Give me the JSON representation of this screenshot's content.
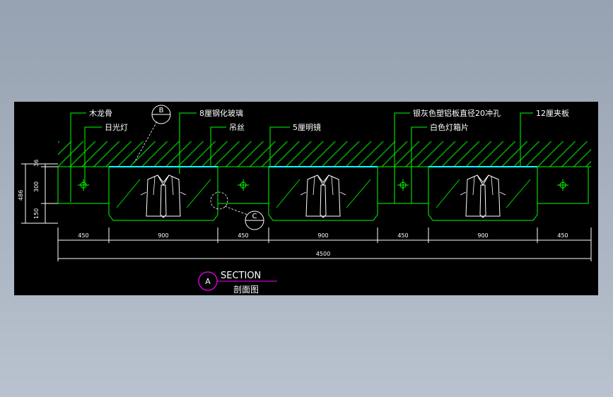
{
  "labels": {
    "wood_keel": "木龙骨",
    "daylight_lamp": "日光灯",
    "tempered_glass": "8厘钢化玻璃",
    "hanging_wire": "吊丝",
    "mirror": "5厘明镜",
    "perforated_panel": "银灰色塑铝板直径20冲孔",
    "lightbox_sheet": "白色灯箱片",
    "plywood": "12厘夹板"
  },
  "callouts": {
    "b": "B",
    "c": "C",
    "a": "A"
  },
  "dimensions": {
    "bays": [
      "450",
      "900",
      "450",
      "900",
      "450",
      "900",
      "450"
    ],
    "total": "4500",
    "vertical": [
      "36",
      "300",
      "150"
    ],
    "overall_height": "486"
  },
  "title": {
    "en": "SECTION",
    "zh": "剖面图"
  },
  "colors": {
    "background": "#000000",
    "outline": "#00ff00",
    "dimension": "#ffffff",
    "hatch": "#00aa00",
    "glass": "#00ffff",
    "title_circle": "#ff00ff"
  }
}
